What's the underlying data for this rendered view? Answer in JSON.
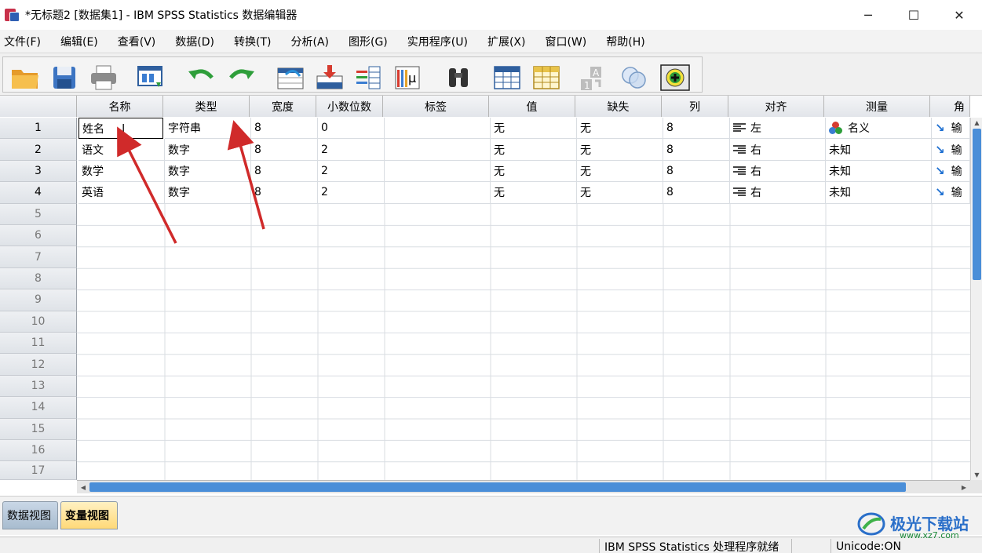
{
  "window": {
    "title": "*无标题2 [数据集1] - IBM SPSS Statistics 数据编辑器",
    "minimize": "─",
    "maximize": "☐",
    "close": "✕"
  },
  "menu": [
    "文件(F)",
    "编辑(E)",
    "查看(V)",
    "数据(D)",
    "转换(T)",
    "分析(A)",
    "图形(G)",
    "实用程序(U)",
    "扩展(X)",
    "窗口(W)",
    "帮助(H)"
  ],
  "toolbar_icons": [
    "open-folder-icon",
    "save-icon",
    "print-icon",
    "recall-dialog-icon",
    "undo-icon",
    "redo-icon",
    "goto-case-icon",
    "goto-variable-icon",
    "variables-icon",
    "descriptive-stats-icon",
    "find-icon",
    "insert-cases-icon",
    "insert-variable-icon",
    "split-file-icon",
    "weight-cases-icon",
    "select-cases-icon",
    "value-labels-icon"
  ],
  "columns": [
    "名称",
    "类型",
    "宽度",
    "小数位数",
    "标签",
    "值",
    "缺失",
    "列",
    "对齐",
    "测量",
    "角"
  ],
  "rows": [
    {
      "num": "1",
      "name": "姓名",
      "type": "字符串",
      "width": "8",
      "decimals": "0",
      "label": "",
      "values": "无",
      "missing": "无",
      "columns": "8",
      "align": "左",
      "measure": "名义",
      "role": "输"
    },
    {
      "num": "2",
      "name": "语文",
      "type": "数字",
      "width": "8",
      "decimals": "2",
      "label": "",
      "values": "无",
      "missing": "无",
      "columns": "8",
      "align": "右",
      "measure": "未知",
      "role": "输"
    },
    {
      "num": "3",
      "name": "数学",
      "type": "数字",
      "width": "8",
      "decimals": "2",
      "label": "",
      "values": "无",
      "missing": "无",
      "columns": "8",
      "align": "右",
      "measure": "未知",
      "role": "输"
    },
    {
      "num": "4",
      "name": "英语",
      "type": "数字",
      "width": "8",
      "decimals": "2",
      "label": "",
      "values": "无",
      "missing": "无",
      "columns": "8",
      "align": "右",
      "measure": "未知",
      "role": "输"
    }
  ],
  "empty_row_numbers": [
    "5",
    "6",
    "7",
    "8",
    "9",
    "10",
    "11",
    "12",
    "13",
    "14",
    "15",
    "16",
    "17"
  ],
  "tabs": {
    "data_view": "数据视图",
    "variable_view": "变量视图",
    "active": "variable_view"
  },
  "status": {
    "processor": "IBM SPSS Statistics 处理程序就绪",
    "unicode": "Unicode:ON"
  },
  "watermark": {
    "text": "极光下载站",
    "url": "www.xz7.com"
  },
  "colors": {
    "annotation_arrow": "#d02a2a",
    "scroll_thumb": "#4a8ed8",
    "active_tab": "#ffd978"
  }
}
